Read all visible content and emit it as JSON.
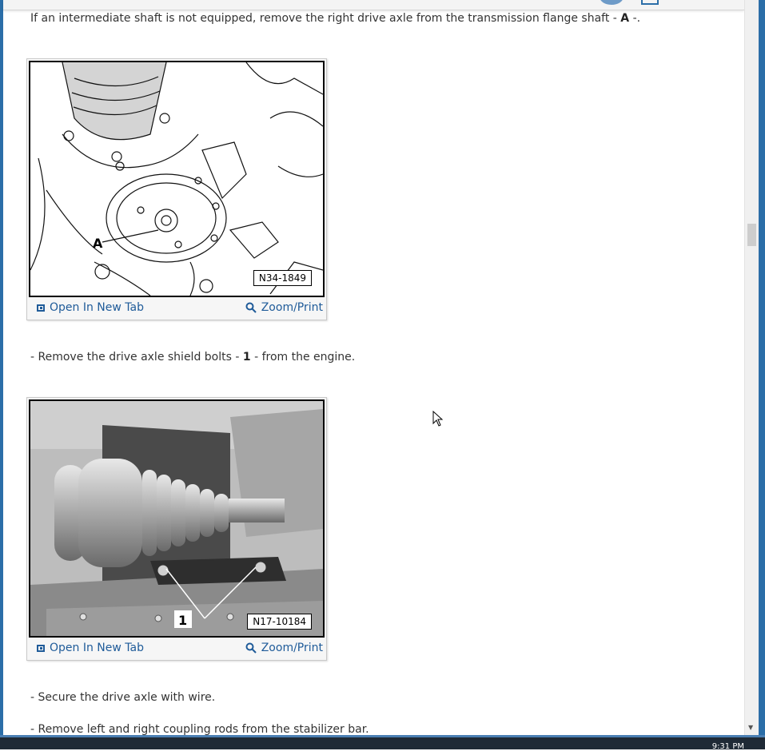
{
  "step_intro": {
    "text": "If an intermediate shaft is not equipped, remove the right drive axle from the transmission flange shaft - ",
    "ref": "A",
    "suffix": " -."
  },
  "figures": [
    {
      "label": "N34-1849",
      "callout": "A",
      "open_label": "Open In New Tab",
      "zoom_label": "Zoom/Print"
    },
    {
      "label": "N17-10184",
      "callout": "1",
      "open_label": "Open In New Tab",
      "zoom_label": "Zoom/Print"
    }
  ],
  "steps": [
    {
      "prefix": "-  Remove the drive axle shield bolts - ",
      "ref": "1",
      "suffix": " - from the engine."
    },
    {
      "text": "-  Secure the drive axle with wire."
    },
    {
      "text": "-  Remove left and right coupling rods from the stabilizer bar."
    }
  ],
  "taskbar": {
    "clock": "9:31 PM"
  }
}
